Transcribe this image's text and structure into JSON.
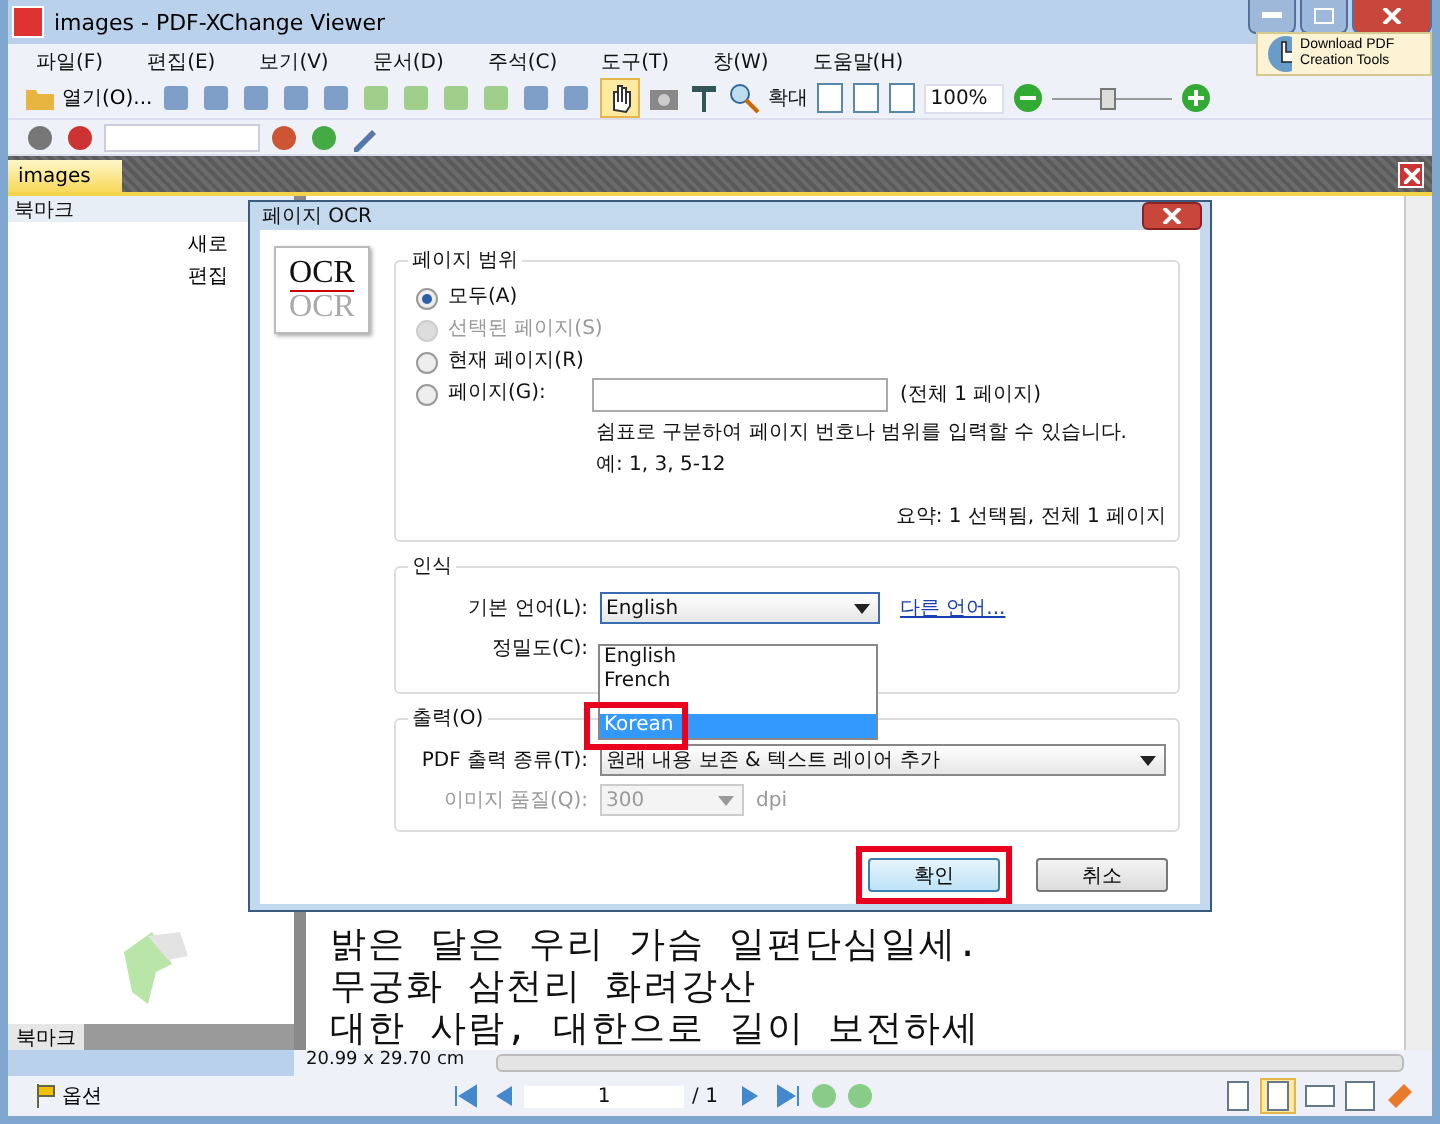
{
  "window": {
    "title": "images - PDF-XChange Viewer",
    "promo": "Download PDF Creation Tools"
  },
  "menu": [
    {
      "label": "파일(F)"
    },
    {
      "label": "편집(E)"
    },
    {
      "label": "보기(V)"
    },
    {
      "label": "문서(D)"
    },
    {
      "label": "주석(C)"
    },
    {
      "label": "도구(T)"
    },
    {
      "label": "창(W)"
    },
    {
      "label": "도움말(H)"
    }
  ],
  "toolbar": {
    "open_label": "열기(O)...",
    "zoom_label": "확대",
    "zoom_value": "100%",
    "zoom_slider": {
      "level": 0.45
    }
  },
  "doc_tabs": [
    {
      "label": "images",
      "selected": true
    }
  ],
  "bookmarks": {
    "title": "북마크",
    "tools": [
      "새로",
      "편집"
    ],
    "tab": "북마크"
  },
  "document": {
    "lines": [
      "밝은 달은 우리 가슴 일편단심일세.",
      "무궁화 삼천리 화려강산",
      "대한 사람, 대한으로 길이 보전하세"
    ]
  },
  "status": {
    "page_size": "20.99 x 29.70 cm",
    "options": "옵션",
    "page": "1",
    "page_total": "/ 1"
  },
  "dialog": {
    "title": "페이지 OCR",
    "logo_text": "OCR",
    "logo_reflection": "OCR",
    "range": {
      "title": "페이지 범위",
      "options": [
        {
          "label": "모두(A)",
          "selected": true,
          "disabled": false
        },
        {
          "label": "선택된 페이지(S)",
          "selected": false,
          "disabled": true
        },
        {
          "label": "현재 페이지(R)",
          "selected": false,
          "disabled": false
        },
        {
          "label": "페이지(G):",
          "selected": false,
          "disabled": false
        }
      ],
      "page_count": "(전체 1 페이지)",
      "hint": "쉼표로 구분하여 페이지 번호나 범위를 입력할 수 있습니다.",
      "example": "예: 1, 3, 5-12",
      "summary": "요약: 1 선택됨, 전체 1 페이지"
    },
    "recognition": {
      "title": "인식",
      "language_label": "기본 언어(L):",
      "language_value": "English",
      "other_link": "다른 언어...",
      "accuracy_label": "정밀도(C):",
      "languages": [
        {
          "label": "English",
          "selected": false,
          "highlighted": false
        },
        {
          "label": "French",
          "selected": false,
          "highlighted": false
        },
        {
          "label": "Korean",
          "selected": true,
          "highlighted": true
        }
      ]
    },
    "output": {
      "title": "출력(O)",
      "type_label": "PDF 출력 종류(T):",
      "type_value": "원래 내용 보존 & 텍스트 레이어 추가",
      "quality_label": "이미지 품질(Q):",
      "quality_value": "300",
      "quality_unit": "dpi",
      "quality_disabled": true
    },
    "buttons": [
      {
        "label": "확인",
        "highlighted": true
      },
      {
        "label": "취소",
        "highlighted": false
      }
    ]
  }
}
